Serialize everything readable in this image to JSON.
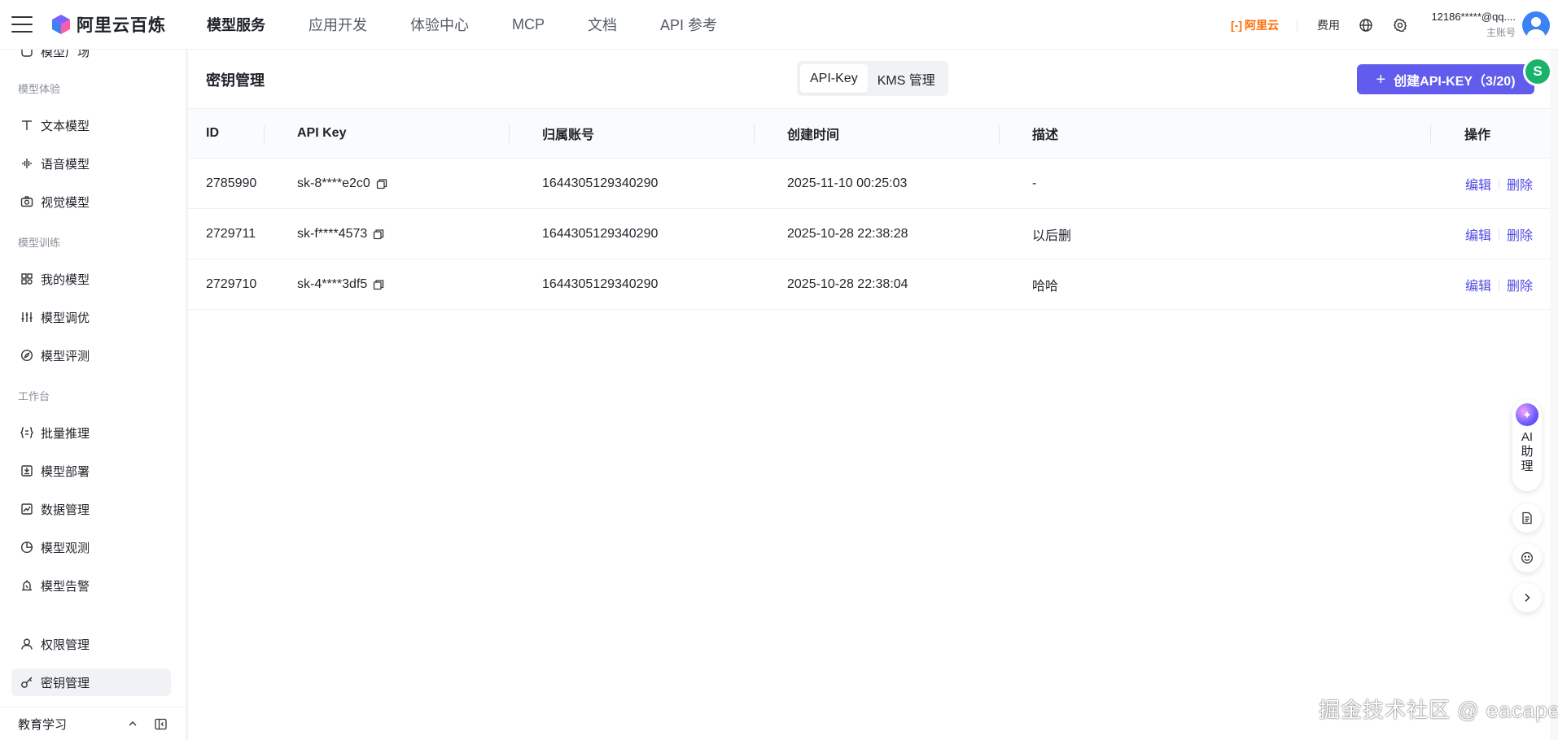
{
  "header": {
    "brand": "阿里云百炼",
    "nav": [
      {
        "label": "模型服务",
        "active": true
      },
      {
        "label": "应用开发",
        "active": false
      },
      {
        "label": "体验中心",
        "active": false
      },
      {
        "label": "MCP",
        "active": false
      },
      {
        "label": "文档",
        "active": false
      },
      {
        "label": "API 参考",
        "active": false
      }
    ],
    "aliyun_logo": "阿里云",
    "billing": "费用",
    "account_name": "12186*****@qq....",
    "account_role": "主账号"
  },
  "sidebar": {
    "partial_top": "模型广场",
    "groups": {
      "experience": "模型体验",
      "training": "模型训练",
      "workbench": "工作台"
    },
    "items": [
      {
        "label": "文本模型",
        "icon": "text-t-icon"
      },
      {
        "label": "语音模型",
        "icon": "waveform-icon"
      },
      {
        "label": "视觉模型",
        "icon": "camera-icon"
      },
      {
        "label": "我的模型",
        "icon": "grid-icon"
      },
      {
        "label": "模型调优",
        "icon": "sliders-icon"
      },
      {
        "label": "模型评测",
        "icon": "compass-icon"
      },
      {
        "label": "批量推理",
        "icon": "braces-list-icon"
      },
      {
        "label": "模型部署",
        "icon": "deploy-icon"
      },
      {
        "label": "数据管理",
        "icon": "chart-icon"
      },
      {
        "label": "模型观测",
        "icon": "pie-icon"
      },
      {
        "label": "模型告警",
        "icon": "alarm-icon"
      },
      {
        "label": "权限管理",
        "icon": "user-icon"
      },
      {
        "label": "密钥管理",
        "icon": "key-icon",
        "active": true
      }
    ],
    "bottom_label": "教育学习"
  },
  "main": {
    "title": "密钥管理",
    "tabs": [
      {
        "label": "API-Key",
        "active": true
      },
      {
        "label": "KMS 管理",
        "active": false
      }
    ],
    "create_button": "创建API-KEY（3/20)",
    "columns": [
      "ID",
      "API Key",
      "归属账号",
      "创建时间",
      "描述",
      "操作"
    ],
    "rows": [
      {
        "id": "2785990",
        "key": "sk-8****e2c0",
        "account": "1644305129340290",
        "created": "2025-11-10 00:25:03",
        "desc": "-"
      },
      {
        "id": "2729711",
        "key": "sk-f****4573",
        "account": "1644305129340290",
        "created": "2025-10-28 22:38:28",
        "desc": "以后删"
      },
      {
        "id": "2729710",
        "key": "sk-4****3df5",
        "account": "1644305129340290",
        "created": "2025-10-28 22:38:04",
        "desc": "哈哈"
      }
    ],
    "edit_label": "编辑",
    "delete_label": "删除"
  },
  "floating": {
    "ai_assistant": "AI助理"
  },
  "watermark": "掘金技术社区 @ eacape",
  "colors": {
    "accent": "#615ced",
    "link": "#4f4ae0",
    "aliyun_orange": "#ff6a00"
  }
}
